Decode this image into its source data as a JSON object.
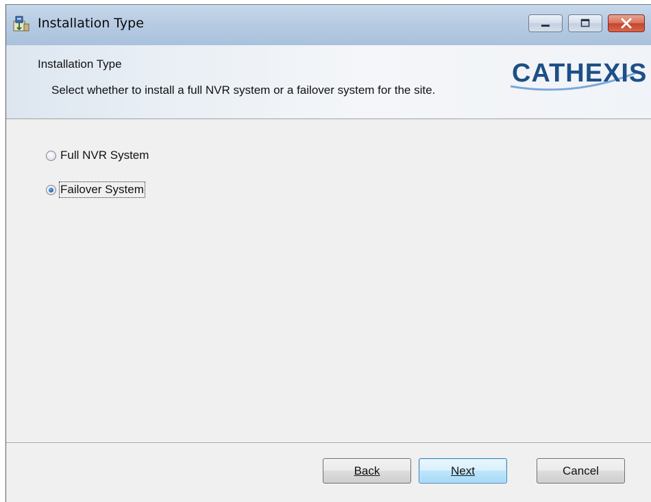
{
  "window": {
    "title": "Installation Type"
  },
  "banner": {
    "title": "Installation Type",
    "description": "Select whether to install a full NVR system or a failover system for the site.",
    "logo_text": "CATHEXIS",
    "logo_color": "#1e4f86"
  },
  "options": [
    {
      "label": "Full NVR System",
      "selected": false
    },
    {
      "label": "Failover System",
      "selected": true
    }
  ],
  "buttons": {
    "back_label": "Back",
    "next_label": "Next",
    "cancel_label": "Cancel"
  },
  "icons": {
    "app": "installer-icon",
    "minimize": "minimize-icon",
    "maximize": "maximize-icon",
    "close": "close-icon"
  }
}
